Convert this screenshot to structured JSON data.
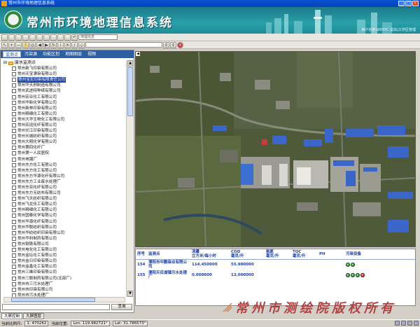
{
  "window": {
    "title": "常州市环境地理信息系统"
  },
  "banner": {
    "title": "常州市环境地理信息系统",
    "userinfo": "用户名称:WRYPC   退出|工作区管理"
  },
  "toolbar": {
    "coord_field": "地理信息"
  },
  "left_panel": {
    "tabs": [
      "监测点",
      "污染源",
      "功能区划",
      "地图图层",
      "视频"
    ],
    "root_label": "废水监测点",
    "items": [
      "常州新飞印染有限公司",
      "常州天宝漂染有限公司",
      "常州宝宏印染有限责任公司",
      "常州华天刷制造有限公司",
      "常州武进特种纸有限公司",
      "常州宏业化工有限公司",
      "常州华新化学有限公司",
      "常州新林印染有限公司",
      "常州精细化工有限公司",
      "常州大华生物化工有限公司",
      "常州宏运化纤有限公司",
      "常州长江印染有限公司",
      "常州长城纺织有限公司",
      "常州大明化学有限公司",
      "常州第四化纤厂",
      "常州第一人民医院",
      "常州电镀厂",
      "常州东方化工有限公司",
      "常州东方化工有限公司",
      "常州东方华源化纤有限公司",
      "常州东方工业废水处理厂",
      "常州东亚化纤有限公司",
      "常州东方无纺布有限公司",
      "常州飞天纺织有限公司",
      "常州飞龙化工有限公司",
      "常州精细化工有限公司",
      "常州国泰化学有限公司",
      "常州华源化纤有限公司",
      "常州华联纺织有限公司",
      "常州华纺纺织印染有限公司",
      "常州华利制药有限公司",
      "常州钢铁有限公司",
      "常州电化化工有限公司",
      "常州金坛化工有限公司",
      "常州金日印染有限公司",
      "常州金鑫化工有限公司",
      "常州三维印染有限公司",
      "常州三联制药有限公司(北部厂)",
      "常州市三污水处理厂",
      "常州市印染有限公司",
      "常州市污水处理厂"
    ],
    "selected_index": 2,
    "query_button": "查询"
  },
  "grid": {
    "headers": [
      "序号",
      "监测点",
      "流量\n立方米/每小时",
      "COD\n毫克/升",
      "氨氮\n毫克/升",
      "TOC\n毫克/升",
      "PH",
      "污染设备"
    ],
    "rows": [
      {
        "index": "154",
        "name": "溧阳市中鹏染业有限公司",
        "flow": "114.450000",
        "cod": "55.900000",
        "nh3": "",
        "toc": "",
        "ph": "",
        "lights": [
          "green",
          "green"
        ]
      },
      {
        "index": "155",
        "name": "溧阳天目湖镇污水处理厂",
        "flow": "0.000000",
        "cod": "12.000000",
        "nh3": "",
        "toc": "",
        "ph": "",
        "lights": [
          "green",
          "green",
          "green",
          "red"
        ]
      }
    ]
  },
  "bottom_tabs": [
    "大屏控制",
    "大屏图层"
  ],
  "status": {
    "scale_label": "当前比例尺:",
    "scale_value": "1: 470262",
    "position_label": "当前位置:",
    "lon": "Lon: 119.982721°",
    "lat": "Lat: 31.786573°"
  },
  "watermark": "常州市测绘院版权所有",
  "colors": {
    "banner": "#1f8c98",
    "accent": "#2f5fa0",
    "grid_text": "#1f3fa0"
  }
}
